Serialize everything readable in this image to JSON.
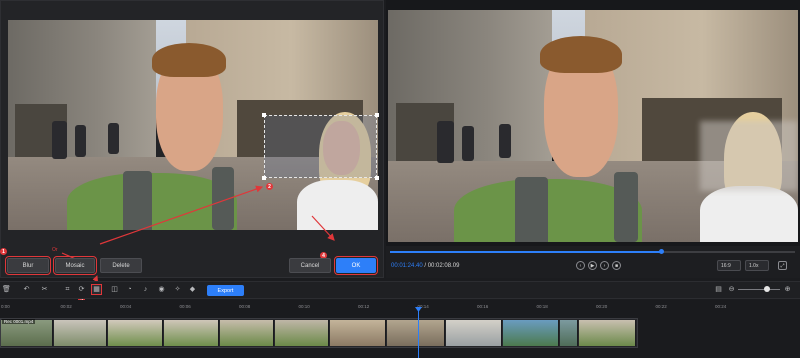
{
  "left_panel": {
    "buttons": {
      "blur": "Blur",
      "mosaic": "Mosaic",
      "delete": "Delete",
      "cancel": "Cancel",
      "ok": "OK"
    },
    "or_label": "Or",
    "markers": [
      "1",
      "2",
      "3",
      "4"
    ]
  },
  "player": {
    "time_current": "00:01:24.40",
    "time_separator": "/",
    "time_total": "00:02:08.09",
    "ratio": "16:9",
    "speed": "1.0x",
    "progress": 0.67
  },
  "toolbar": {
    "export_label": "Export"
  },
  "timeline": {
    "ruler": [
      "0:00",
      "00:02",
      "00:04",
      "00:06",
      "00:08",
      "00:10",
      "00:12",
      "00:14",
      "00:16",
      "00:18",
      "00:20",
      "00:22",
      "00:24"
    ],
    "clip_label": "Rec 0001.mp4"
  },
  "colors": {
    "accent": "#2d7ff9",
    "highlight": "#e0373a"
  }
}
